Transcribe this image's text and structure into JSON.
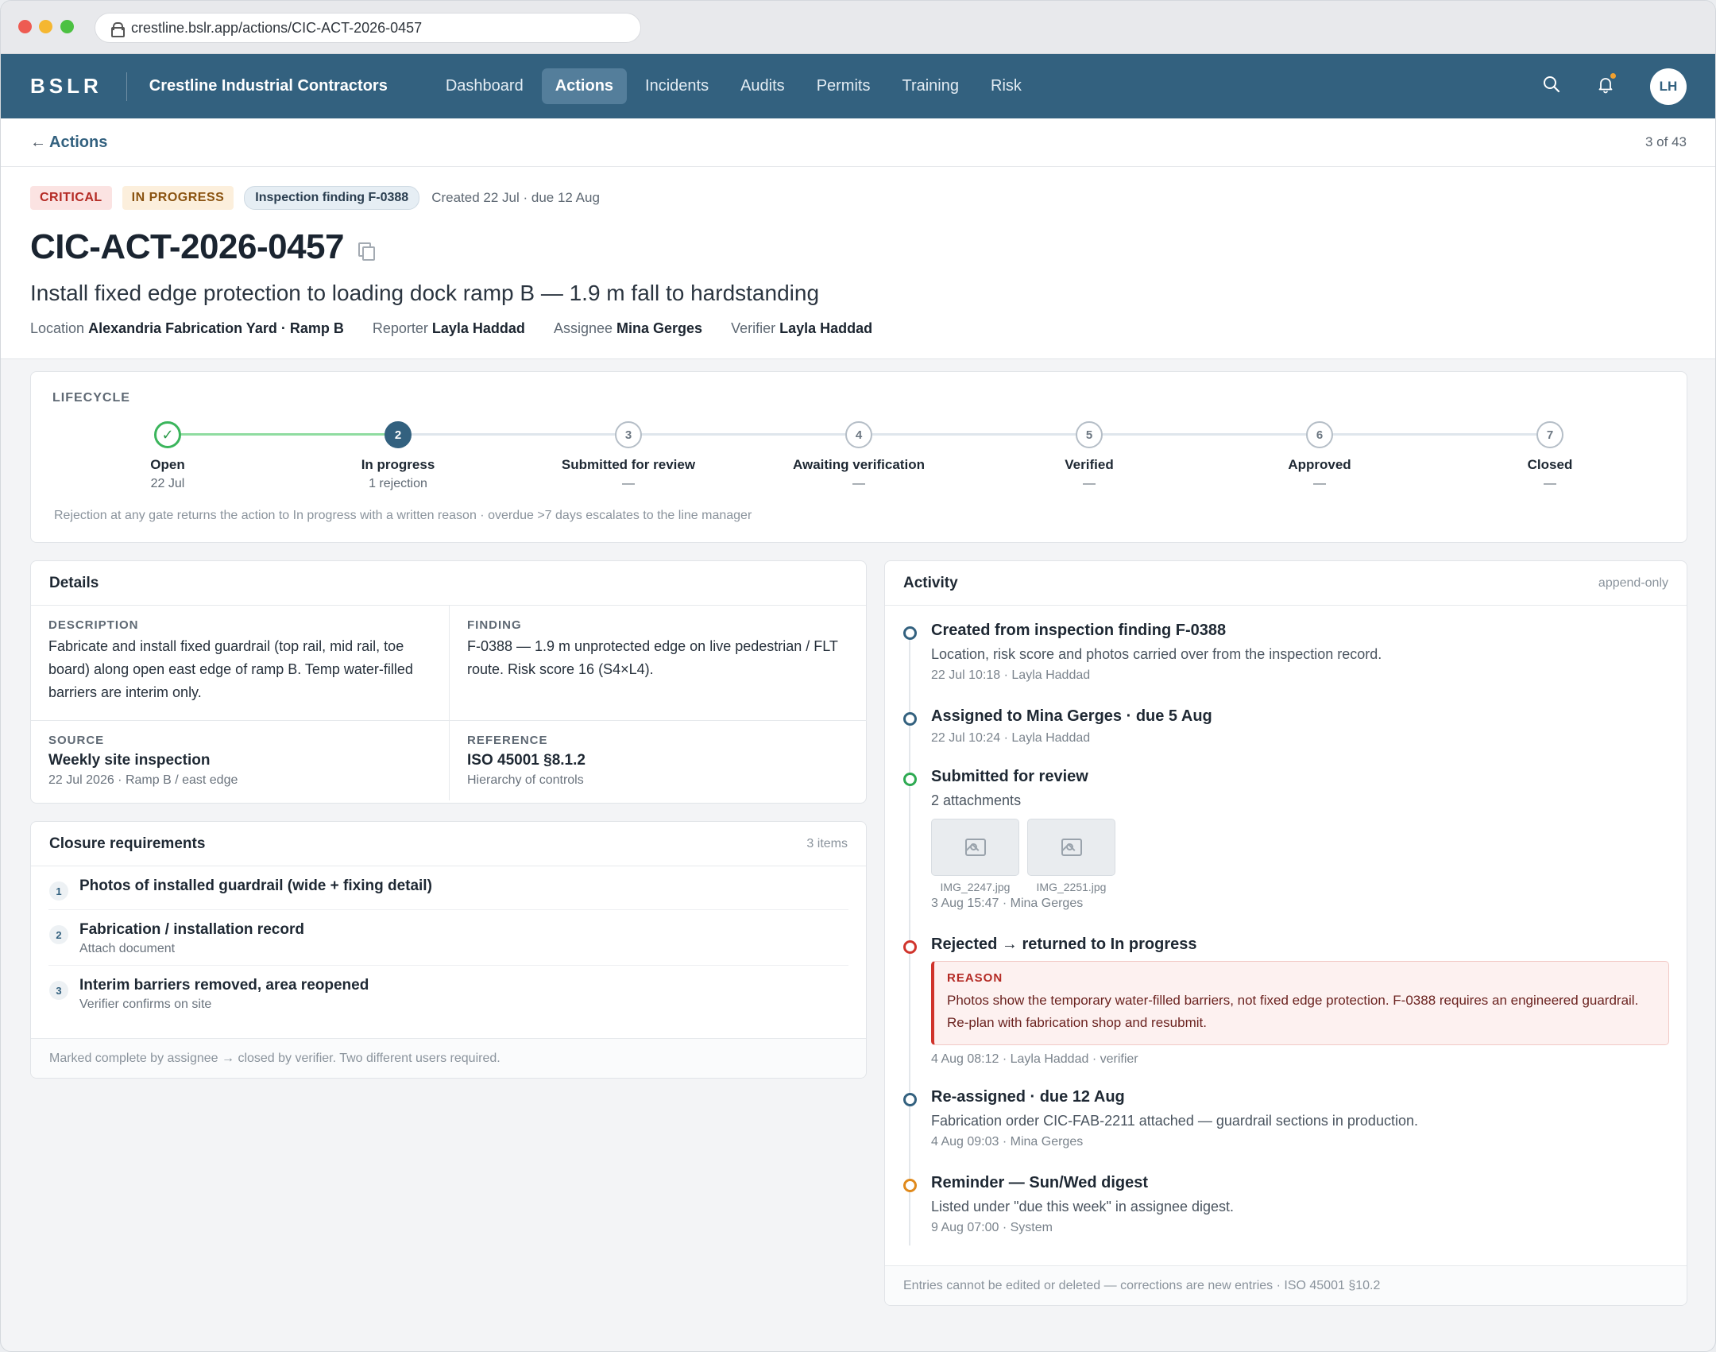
{
  "browser": {
    "url": "crestline.bslr.app/actions/CIC-ACT-2026-0457"
  },
  "nav": {
    "brand": "BSLR",
    "org": "Crestline Industrial Contractors",
    "links": [
      "Dashboard",
      "Actions",
      "Incidents",
      "Audits",
      "Permits",
      "Training",
      "Risk"
    ],
    "active": "Actions",
    "user_initials": "LH"
  },
  "back": {
    "label": "Actions",
    "arrow": "←",
    "pager": "3 of 43"
  },
  "header": {
    "severity": "CRITICAL",
    "status": "IN PROGRESS",
    "finding_chip": "Inspection finding F-0388",
    "created": "Created 22 Jul · due 12 Aug",
    "id": "CIC-ACT-2026-0457",
    "title": "Install fixed edge protection to loading dock ramp B — 1.9 m fall to hardstanding",
    "meta": [
      {
        "label": "Location",
        "value": "Alexandria Fabrication Yard · Ramp B"
      },
      {
        "label": "Reporter",
        "value": "Layla Haddad"
      },
      {
        "label": "Assignee",
        "value": "Mina Gerges"
      },
      {
        "label": "Verifier",
        "value": "Layla Haddad"
      }
    ]
  },
  "lifecycle": {
    "label": "LIFECYCLE",
    "steps": [
      {
        "num": "✓",
        "label": "Open",
        "sub": "22 Jul",
        "state": "done"
      },
      {
        "num": "2",
        "label": "In progress",
        "sub": "1 rejection",
        "state": "current"
      },
      {
        "num": "3",
        "label": "Submitted for review",
        "sub": "—",
        "state": "todo"
      },
      {
        "num": "4",
        "label": "Awaiting verification",
        "sub": "—",
        "state": "todo"
      },
      {
        "num": "5",
        "label": "Verified",
        "sub": "—",
        "state": "todo"
      },
      {
        "num": "6",
        "label": "Approved",
        "sub": "—",
        "state": "todo"
      },
      {
        "num": "7",
        "label": "Closed",
        "sub": "—",
        "state": "todo"
      }
    ],
    "note": "Rejection at any gate returns the action to In progress with a written reason · overdue >7 days escalates to the line manager"
  },
  "details": {
    "title": "Details",
    "description_label": "DESCRIPTION",
    "description": "Fabricate and install fixed guardrail (top rail, mid rail, toe board) along open east edge of ramp B. Temp water-filled barriers are interim only.",
    "finding_label": "FINDING",
    "finding": "F-0388 — 1.9 m unprotected edge on live pedestrian / FLT route. Risk score 16 (S4×L4).",
    "source_label": "SOURCE",
    "source": "Weekly site inspection",
    "source_sub": "22 Jul 2026 · Ramp B / east edge",
    "reference_label": "REFERENCE",
    "reference": "ISO 45001 §8.1.2",
    "reference_sub": "Hierarchy of controls"
  },
  "closure": {
    "title": "Closure requirements",
    "count": "3 items",
    "items": [
      {
        "num": "1",
        "title": "Photos of installed guardrail (wide + fixing detail)",
        "sub": ""
      },
      {
        "num": "2",
        "title": "Fabrication / installation record",
        "sub": "Attach document"
      },
      {
        "num": "3",
        "title": "Interim barriers removed, area reopened",
        "sub": "Verifier confirms on site"
      }
    ],
    "footer": "Marked complete by assignee → closed by verifier. Two different users required."
  },
  "activity": {
    "title": "Activity",
    "mode": "append-only",
    "entries": [
      {
        "title": "Created from inspection finding F-0388",
        "text": "Location, risk score and photos carried over from the inspection record.",
        "meta": "22 Jul 10:18 · Layla Haddad"
      },
      {
        "title": "Assigned to Mina Gerges · due 5 Aug",
        "meta": "22 Jul 10:24 · Layla Haddad"
      },
      {
        "title": "Submitted for review",
        "text": "2 attachments",
        "attachments": [
          "IMG_2247.jpg",
          "IMG_2251.jpg"
        ],
        "meta": "3 Aug 15:47 · Mina Gerges"
      },
      {
        "title": "Rejected → returned to In progress",
        "reason_label": "REASON",
        "reason": "Photos show the temporary water-filled barriers, not fixed edge protection. F-0388 requires an engineered guardrail. Re-plan with fabrication shop and resubmit.",
        "meta": "4 Aug 08:12 · Layla Haddad · verifier"
      },
      {
        "title": "Re-assigned · due 12 Aug",
        "text": "Fabrication order CIC-FAB-2211 attached — guardrail sections in production.",
        "meta": "4 Aug 09:03 · Mina Gerges"
      },
      {
        "title": "Reminder — Sun/Wed digest",
        "text": "Listed under \"due this week\" in assignee digest.",
        "meta": "9 Aug 07:00 · System"
      }
    ],
    "footer": "Entries cannot be edited or deleted — corrections are new entries · ISO 45001 §10.2"
  },
  "colors": {
    "nav": "#33617f",
    "critical": "#b42a24",
    "success": "#2eaa52",
    "warning": "#e08a1c"
  }
}
